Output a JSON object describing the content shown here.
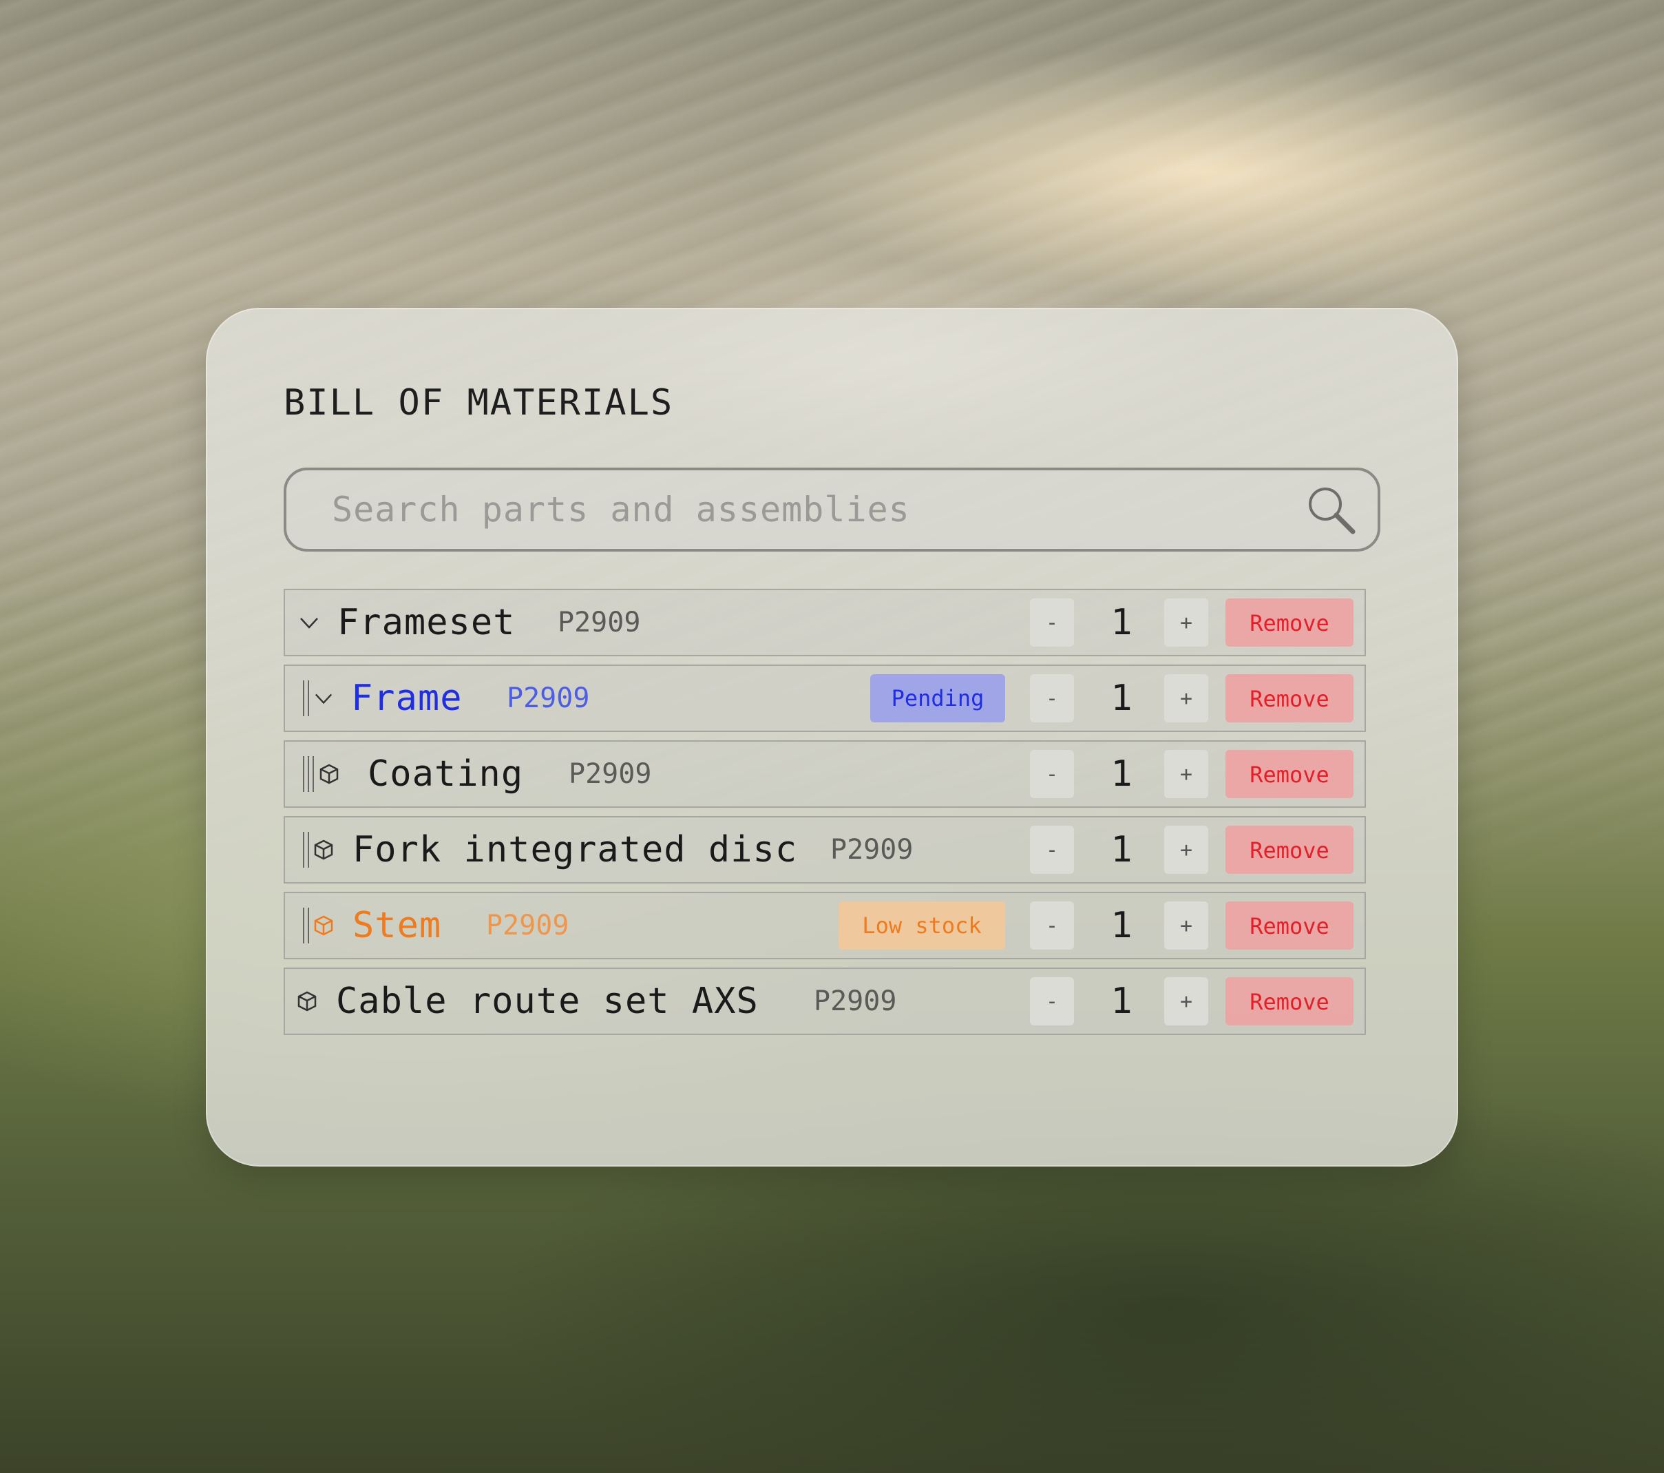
{
  "title": "BILL OF MATERIALS",
  "search": {
    "placeholder": "Search parts and assemblies",
    "value": ""
  },
  "colors": {
    "accent_blue": "#1f2ee0",
    "warning_orange": "#f07a1e",
    "danger_red": "#e3202a"
  },
  "rows": [
    {
      "name": "Frameset",
      "code": "P2909",
      "qty": "1",
      "minus": "-",
      "plus": "+",
      "remove": "Remove",
      "icon": "chevron-down-icon"
    },
    {
      "name": "Frame",
      "code": "P2909",
      "qty": "1",
      "minus": "-",
      "plus": "+",
      "remove": "Remove",
      "badge": "Pending",
      "icon": "chevron-down-icon"
    },
    {
      "name": "Coating",
      "code": "P2909",
      "qty": "1",
      "minus": "-",
      "plus": "+",
      "remove": "Remove",
      "icon": "cube-icon"
    },
    {
      "name": "Fork integrated disc",
      "code": "P2909",
      "qty": "1",
      "minus": "-",
      "plus": "+",
      "remove": "Remove",
      "icon": "cube-icon"
    },
    {
      "name": "Stem",
      "code": "P2909",
      "qty": "1",
      "minus": "-",
      "plus": "+",
      "remove": "Remove",
      "badge": "Low stock",
      "icon": "cube-icon"
    },
    {
      "name": "Cable route set AXS",
      "code": "P2909",
      "qty": "1",
      "minus": "-",
      "plus": "+",
      "remove": "Remove",
      "icon": "cube-icon"
    }
  ]
}
